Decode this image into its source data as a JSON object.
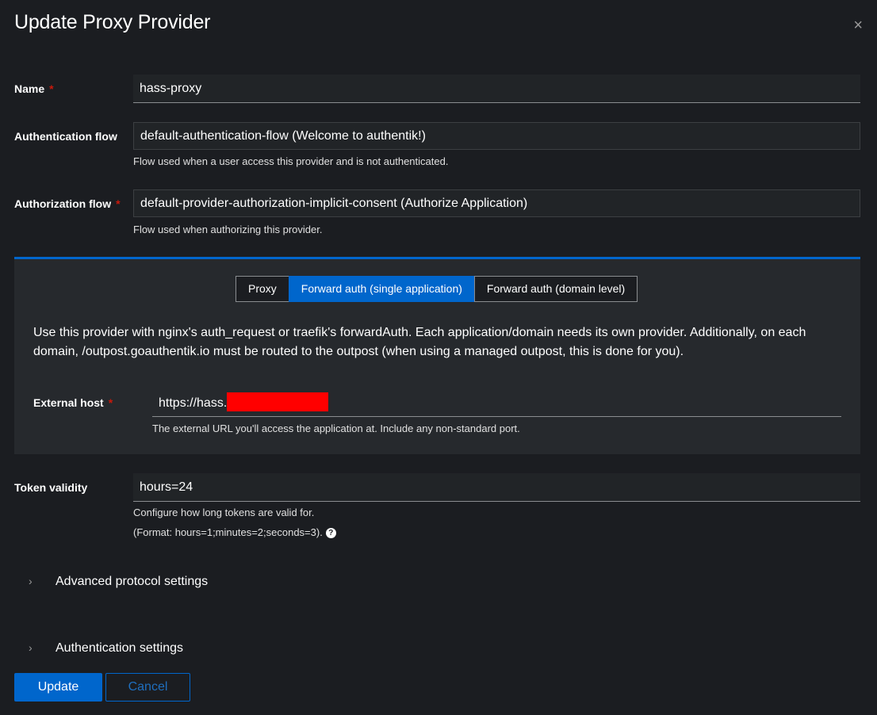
{
  "dialog": {
    "title": "Update Proxy Provider",
    "close_glyph": "×"
  },
  "fields": {
    "name": {
      "label": "Name",
      "required_mark": "*",
      "value": "hass-proxy"
    },
    "auth_flow": {
      "label": "Authentication flow",
      "value": "default-authentication-flow (Welcome to authentik!)",
      "help": "Flow used when a user access this provider and is not authenticated."
    },
    "authz_flow": {
      "label": "Authorization flow",
      "required_mark": "*",
      "value": "default-provider-authorization-implicit-consent (Authorize Application)",
      "help": "Flow used when authorizing this provider."
    },
    "token": {
      "label": "Token validity",
      "value": "hours=24",
      "help1": "Configure how long tokens are valid for.",
      "help2": "(Format: hours=1;minutes=2;seconds=3)."
    }
  },
  "mode": {
    "options": [
      "Proxy",
      "Forward auth (single application)",
      "Forward auth (domain level)"
    ],
    "selected": "Forward auth (single application)",
    "description": "Use this provider with nginx's auth_request or traefik's forwardAuth. Each application/domain needs its own provider. Additionally, on each domain, /outpost.goauthentik.io must be routed to the outpost (when using a managed outpost, this is done for you).",
    "external_host": {
      "label": "External host",
      "required_mark": "*",
      "value_prefix": "https://hass.",
      "help": "The external URL you'll access the application at. Include any non-standard port."
    }
  },
  "sections": {
    "advanced": "Advanced protocol settings",
    "auth": "Authentication settings"
  },
  "actions": {
    "update": "Update",
    "cancel": "Cancel"
  },
  "colors": {
    "accent": "#0066cc",
    "background": "#1b1d21",
    "panel": "#26292d",
    "required": "#c9190b",
    "redaction": "#ff0000"
  },
  "icons": {
    "close": "close-icon",
    "help": "question-circle-icon",
    "chevron": "chevron-right-icon"
  }
}
